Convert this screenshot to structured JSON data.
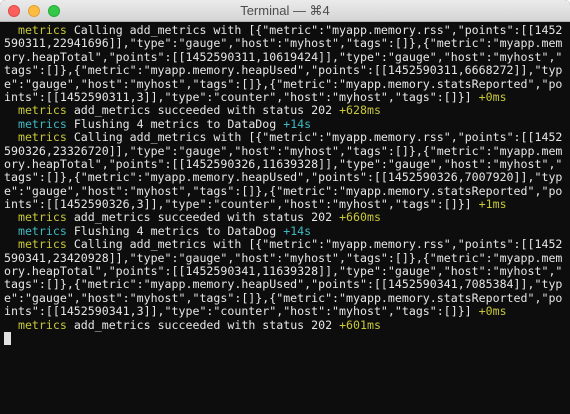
{
  "window": {
    "title": "Terminal — ⌘4"
  },
  "colors": {
    "background": "#0d0d0d",
    "text": "#e6e6e6",
    "metrics_yellow": "#c8c83a",
    "metrics_cyan": "#3fb9c0"
  },
  "lines": [
    {
      "ns": "  metrics ",
      "ns_color": "yellow",
      "text": "Calling add_metrics with [{\"metric\":\"myapp.memory.rss\",\"points\":[[1452",
      "delta": ""
    },
    {
      "ns": "",
      "ns_color": "",
      "text": "590311,22941696]],\"type\":\"gauge\",\"host\":\"myhost\",\"tags\":[]},{\"metric\":\"myapp.mem",
      "delta": ""
    },
    {
      "ns": "",
      "ns_color": "",
      "text": "ory.heapTotal\",\"points\":[[1452590311,10619424]],\"type\":\"gauge\",\"host\":\"myhost\",\"",
      "delta": ""
    },
    {
      "ns": "",
      "ns_color": "",
      "text": "tags\":[]},{\"metric\":\"myapp.memory.heapUsed\",\"points\":[[1452590311,6668272]],\"typ",
      "delta": ""
    },
    {
      "ns": "",
      "ns_color": "",
      "text": "e\":\"gauge\",\"host\":\"myhost\",\"tags\":[]},{\"metric\":\"myapp.memory.statsReported\",\"po",
      "delta": ""
    },
    {
      "ns": "",
      "ns_color": "",
      "text": "ints\":[[1452590311,3]],\"type\":\"counter\",\"host\":\"myhost\",\"tags\":[]}] ",
      "delta": "+0ms",
      "delta_color": "yellow"
    },
    {
      "ns": "  metrics ",
      "ns_color": "yellow",
      "text": "add_metrics succeeded with status 202 ",
      "delta": "+628ms",
      "delta_color": "yellow"
    },
    {
      "ns": "  metrics ",
      "ns_color": "cyan",
      "text": "Flushing 4 metrics to DataDog ",
      "delta": "+14s",
      "delta_color": "cyan"
    },
    {
      "ns": "  metrics ",
      "ns_color": "yellow",
      "text": "Calling add_metrics with [{\"metric\":\"myapp.memory.rss\",\"points\":[[1452",
      "delta": ""
    },
    {
      "ns": "",
      "ns_color": "",
      "text": "590326,23326720]],\"type\":\"gauge\",\"host\":\"myhost\",\"tags\":[]},{\"metric\":\"myapp.mem",
      "delta": ""
    },
    {
      "ns": "",
      "ns_color": "",
      "text": "ory.heapTotal\",\"points\":[[1452590326,11639328]],\"type\":\"gauge\",\"host\":\"myhost\",\"",
      "delta": ""
    },
    {
      "ns": "",
      "ns_color": "",
      "text": "tags\":[]},{\"metric\":\"myapp.memory.heapUsed\",\"points\":[[1452590326,7007920]],\"typ",
      "delta": ""
    },
    {
      "ns": "",
      "ns_color": "",
      "text": "e\":\"gauge\",\"host\":\"myhost\",\"tags\":[]},{\"metric\":\"myapp.memory.statsReported\",\"po",
      "delta": ""
    },
    {
      "ns": "",
      "ns_color": "",
      "text": "ints\":[[1452590326,3]],\"type\":\"counter\",\"host\":\"myhost\",\"tags\":[]}] ",
      "delta": "+1ms",
      "delta_color": "yellow"
    },
    {
      "ns": "  metrics ",
      "ns_color": "yellow",
      "text": "add_metrics succeeded with status 202 ",
      "delta": "+660ms",
      "delta_color": "yellow"
    },
    {
      "ns": "  metrics ",
      "ns_color": "cyan",
      "text": "Flushing 4 metrics to DataDog ",
      "delta": "+14s",
      "delta_color": "cyan"
    },
    {
      "ns": "  metrics ",
      "ns_color": "yellow",
      "text": "Calling add_metrics with [{\"metric\":\"myapp.memory.rss\",\"points\":[[1452",
      "delta": ""
    },
    {
      "ns": "",
      "ns_color": "",
      "text": "590341,23420928]],\"type\":\"gauge\",\"host\":\"myhost\",\"tags\":[]},{\"metric\":\"myapp.mem",
      "delta": ""
    },
    {
      "ns": "",
      "ns_color": "",
      "text": "ory.heapTotal\",\"points\":[[1452590341,11639328]],\"type\":\"gauge\",\"host\":\"myhost\",\"",
      "delta": ""
    },
    {
      "ns": "",
      "ns_color": "",
      "text": "tags\":[]},{\"metric\":\"myapp.memory.heapUsed\",\"points\":[[1452590341,7085384]],\"typ",
      "delta": ""
    },
    {
      "ns": "",
      "ns_color": "",
      "text": "e\":\"gauge\",\"host\":\"myhost\",\"tags\":[]},{\"metric\":\"myapp.memory.statsReported\",\"po",
      "delta": ""
    },
    {
      "ns": "",
      "ns_color": "",
      "text": "ints\":[[1452590341,3]],\"type\":\"counter\",\"host\":\"myhost\",\"tags\":[]}] ",
      "delta": "+0ms",
      "delta_color": "yellow"
    },
    {
      "ns": "  metrics ",
      "ns_color": "yellow",
      "text": "add_metrics succeeded with status 202 ",
      "delta": "+601ms",
      "delta_color": "yellow"
    }
  ]
}
